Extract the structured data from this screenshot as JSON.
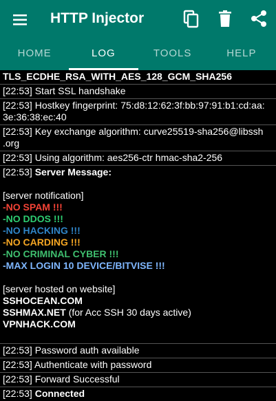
{
  "app": {
    "title": "HTTP Injector"
  },
  "icons": {
    "menu": "menu-icon",
    "copy": "copy-icon",
    "delete": "delete-icon",
    "share": "share-icon"
  },
  "colors": {
    "primary": "#00796b",
    "spam": "#f44336",
    "ddos": "#2ecc71",
    "hacking": "#2f84c6",
    "carding": "#f5a623",
    "cyber": "#3fbf6f",
    "max_login": "#7fb7ff"
  },
  "tabs": [
    {
      "label": "HOME",
      "active": false
    },
    {
      "label": "LOG",
      "active": true
    },
    {
      "label": "TOOLS",
      "active": false
    },
    {
      "label": "HELP",
      "active": false
    }
  ],
  "log": {
    "cipher": "TLS_ECDHE_RSA_WITH_AES_128_GCM_SHA256",
    "e1": {
      "time": "[22:53]",
      "text": "Start SSL handshake"
    },
    "e2": {
      "time": "[22:53]",
      "text1": "Hostkey fingerprint: 75:d8:12:62:3f:bb:97:91:b1:cd:aa:",
      "text2": "3e:36:38:ec:40"
    },
    "e3": {
      "time": "[22:53]",
      "text1": "Key exchange algorithm: curve25519-sha256@libssh",
      "text2": ".org"
    },
    "e4": {
      "time": "[22:53]",
      "text": "Using algorithm: aes256-ctr hmac-sha2-256"
    },
    "e5": {
      "time": "[22:53]",
      "label": "Server Message:",
      "notification": "[server notification]",
      "rules": {
        "spam": "-NO SPAM !!!",
        "ddos": "-NO DDOS !!!",
        "hacking": "-NO HACKING !!!",
        "carding": "-NO CARDING !!!",
        "cyber": "-NO CRIMINAL CYBER !!!",
        "max_login": "-MAX LOGIN 10 DEVICE/BITVISE !!!"
      },
      "hosted": "[server hosted on website]",
      "site1": "SSHOCEAN.COM",
      "site2_name": "SSHMAX.NET",
      "site2_note": "(for Acc SSH 30 days active)",
      "site3": "VPNHACK.COM"
    },
    "e6": {
      "time": "[22:53]",
      "text": "Password auth available"
    },
    "e7": {
      "time": "[22:53]",
      "text": "Authenticate with password"
    },
    "e8": {
      "time": "[22:53]",
      "text": "Forward Successful"
    },
    "e9": {
      "time": "[22:53]",
      "text": "Connected"
    }
  }
}
